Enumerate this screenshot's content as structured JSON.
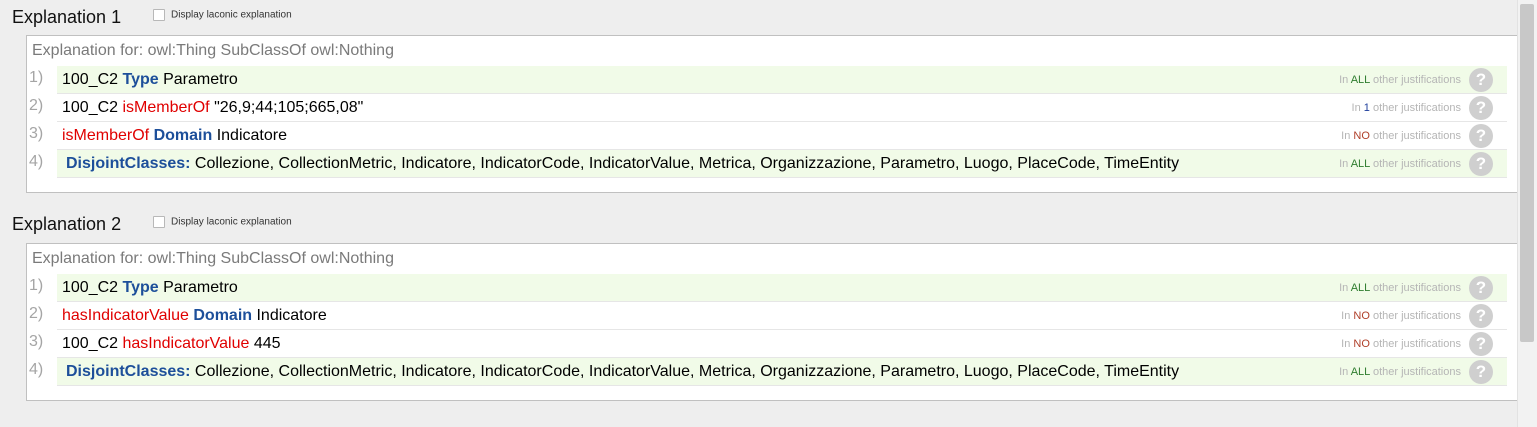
{
  "explanations": [
    {
      "title": "Explanation 1",
      "laconic_label": "Display laconic explanation",
      "laconic_checked": false,
      "caption": "Explanation for: owl:Thing SubClassOf owl:Nothing",
      "axioms": [
        {
          "num": "1)",
          "parts": [
            {
              "text": "100_C2 ",
              "style": "plain"
            },
            {
              "text": "Type",
              "style": "keyword"
            },
            {
              "text": " Parametro",
              "style": "plain"
            }
          ],
          "just": {
            "prefix": "In ",
            "quantity": "ALL",
            "suffix": " other justifications",
            "quantity_color": "green"
          }
        },
        {
          "num": "2)",
          "parts": [
            {
              "text": "100_C2 ",
              "style": "plain"
            },
            {
              "text": "isMemberOf",
              "style": "property"
            },
            {
              "text": " \"26,9;44;105;665,08\"",
              "style": "plain"
            }
          ],
          "just": {
            "prefix": "In ",
            "quantity": "1",
            "suffix": " other justifications",
            "quantity_color": "blue"
          }
        },
        {
          "num": "3)",
          "parts": [
            {
              "text": "isMemberOf",
              "style": "property"
            },
            {
              "text": " ",
              "style": "plain"
            },
            {
              "text": "Domain",
              "style": "keyword"
            },
            {
              "text": " Indicatore",
              "style": "plain"
            }
          ],
          "just": {
            "prefix": "In ",
            "quantity": "NO",
            "suffix": " other justifications",
            "quantity_color": "red"
          }
        },
        {
          "num": "4)",
          "parts": [
            {
              "text": "DisjointClasses:",
              "style": "keyword"
            },
            {
              "text": " Collezione, CollectionMetric, Indicatore, IndicatorCode, IndicatorValue, Metrica, Organizzazione, Parametro, Luogo, PlaceCode, TimeEntity",
              "style": "plain"
            }
          ],
          "just": {
            "prefix": "In ",
            "quantity": "ALL",
            "suffix": " other justifications",
            "quantity_color": "green"
          }
        }
      ]
    },
    {
      "title": "Explanation 2",
      "laconic_label": "Display laconic explanation",
      "laconic_checked": false,
      "caption": "Explanation for: owl:Thing SubClassOf owl:Nothing",
      "axioms": [
        {
          "num": "1)",
          "parts": [
            {
              "text": "100_C2 ",
              "style": "plain"
            },
            {
              "text": "Type",
              "style": "keyword"
            },
            {
              "text": " Parametro",
              "style": "plain"
            }
          ],
          "just": {
            "prefix": "In ",
            "quantity": "ALL",
            "suffix": " other justifications",
            "quantity_color": "green"
          }
        },
        {
          "num": "2)",
          "parts": [
            {
              "text": "hasIndicatorValue",
              "style": "property"
            },
            {
              "text": " ",
              "style": "plain"
            },
            {
              "text": "Domain",
              "style": "keyword"
            },
            {
              "text": " Indicatore",
              "style": "plain"
            }
          ],
          "just": {
            "prefix": "In ",
            "quantity": "NO",
            "suffix": " other justifications",
            "quantity_color": "red"
          }
        },
        {
          "num": "3)",
          "parts": [
            {
              "text": "100_C2 ",
              "style": "plain"
            },
            {
              "text": "hasIndicatorValue",
              "style": "property"
            },
            {
              "text": " 445",
              "style": "plain"
            }
          ],
          "just": {
            "prefix": "In ",
            "quantity": "NO",
            "suffix": " other justifications",
            "quantity_color": "red"
          }
        },
        {
          "num": "4)",
          "parts": [
            {
              "text": "DisjointClasses:",
              "style": "keyword"
            },
            {
              "text": " Collezione, CollectionMetric, Indicatore, IndicatorCode, IndicatorValue, Metrica, Organizzazione, Parametro, Luogo, PlaceCode, TimeEntity",
              "style": "plain"
            }
          ],
          "just": {
            "prefix": "In ",
            "quantity": "ALL",
            "suffix": " other justifications",
            "quantity_color": "green"
          }
        }
      ]
    }
  ],
  "help_icon_glyph": "?",
  "colors": {
    "keyword": "#1d4f9a",
    "property": "#e00000",
    "shaded_row": "#f1fbe8",
    "quantity_all": "#2f7d2f",
    "quantity_one": "#1e3e9c",
    "quantity_no": "#b0402a"
  }
}
